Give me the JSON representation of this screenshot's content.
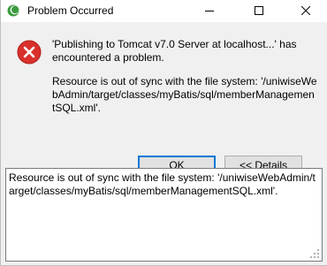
{
  "window": {
    "title": "Problem Occurred",
    "icon": "eclipse-icon",
    "controls": [
      "minimize-icon",
      "maximize-icon",
      "close-icon"
    ]
  },
  "message": {
    "icon": "error-icon",
    "title": "'Publishing to Tomcat v7.0 Server at localhost...' has encountered a problem.",
    "detail": "Resource is out of sync with the file system: '/uniwiseWebAdmin/target/classes/myBatis/sql/memberManagementSQL.xml'."
  },
  "buttons": {
    "ok_label": "OK",
    "details_label": "<< Details"
  },
  "details": {
    "text": "Resource is out of sync with the file system: '/uniwiseWebAdmin/target/classes/myBatis/sql/memberManagementSQL.xml'."
  },
  "colors": {
    "error_red": "#d9302c",
    "focus_blue": "#0078d7",
    "eclipse_green": "#3b9b3f"
  }
}
